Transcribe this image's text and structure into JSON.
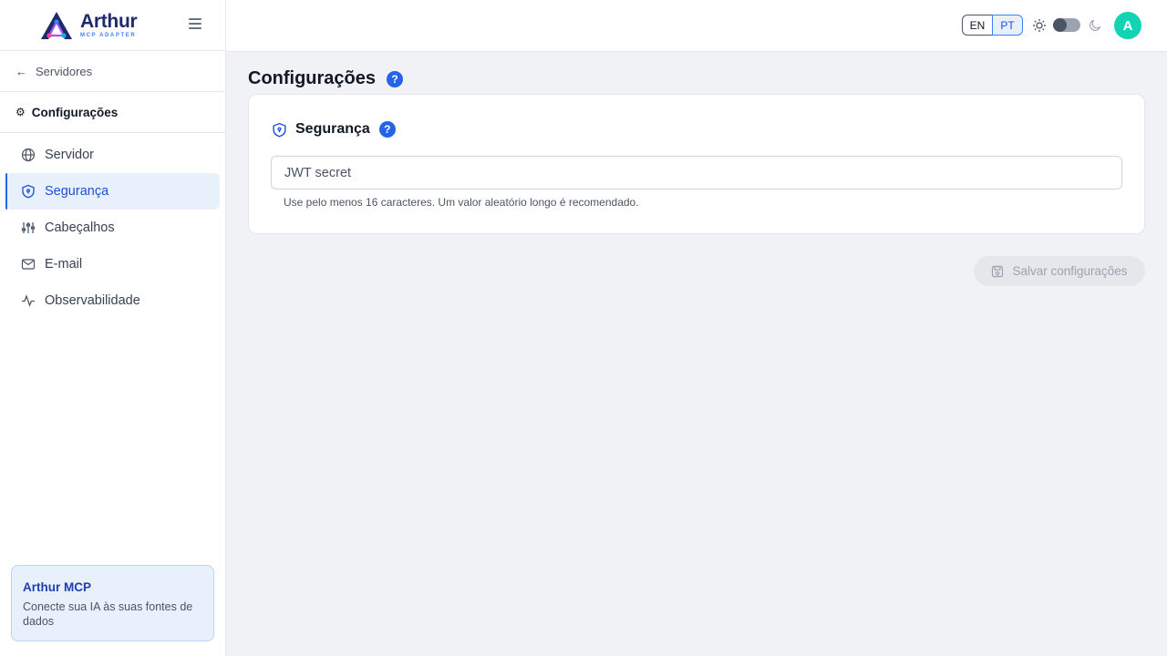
{
  "brand": {
    "title": "Arthur",
    "subtitle": "MCP ADAPTER"
  },
  "sidebar": {
    "back_label": "Servidores",
    "section_title": "Configurações",
    "items": [
      {
        "label": "Servidor",
        "icon": "globe-icon",
        "active": false
      },
      {
        "label": "Segurança",
        "icon": "shield-icon",
        "active": true
      },
      {
        "label": "Cabeçalhos",
        "icon": "sliders-icon",
        "active": false
      },
      {
        "label": "E-mail",
        "icon": "mail-icon",
        "active": false
      },
      {
        "label": "Observabilidade",
        "icon": "activity-icon",
        "active": false
      }
    ],
    "promo": {
      "title": "Arthur MCP",
      "text": "Conecte sua IA às suas fontes de dados"
    }
  },
  "topbar": {
    "lang_en": "EN",
    "lang_pt": "PT",
    "selected_lang": "PT",
    "theme": "light",
    "avatar_initial": "A"
  },
  "main": {
    "page_title": "Configurações",
    "help_glyph": "?",
    "card": {
      "title": "Segurança",
      "input_placeholder": "JWT secret",
      "input_value": "",
      "hint": "Use pelo menos 16 caracteres. Um valor aleatório longo é recomendado."
    },
    "save_label": "Salvar configurações"
  },
  "colors": {
    "accent": "#2563eb",
    "active_bg": "#e8f0fc",
    "avatar": "#14d3b4",
    "brand_dark": "#1e2a6b"
  }
}
